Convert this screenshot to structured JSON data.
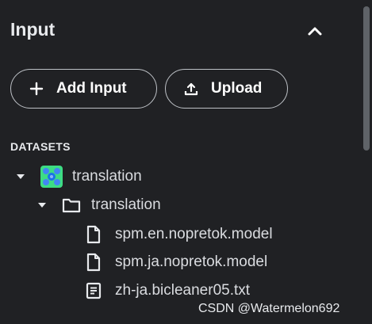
{
  "header": {
    "title": "Input"
  },
  "buttons": {
    "add_input": "Add Input",
    "upload": "Upload"
  },
  "section": {
    "label": "DATASETS"
  },
  "tree": {
    "dataset": {
      "label": "translation"
    },
    "folder": {
      "label": "translation"
    },
    "files": [
      {
        "label": "spm.en.nopretok.model",
        "icon": "file-icon"
      },
      {
        "label": "spm.ja.nopretok.model",
        "icon": "file-icon"
      },
      {
        "label": "zh-ja.bicleaner05.txt",
        "icon": "text-file-icon"
      }
    ]
  },
  "watermark": "CSDN @Watermelon692",
  "colors": {
    "background": "#202124",
    "text": "#e8eaed",
    "dataset_icon_green": "#3ddc84",
    "dataset_icon_blue": "#4285f4"
  }
}
